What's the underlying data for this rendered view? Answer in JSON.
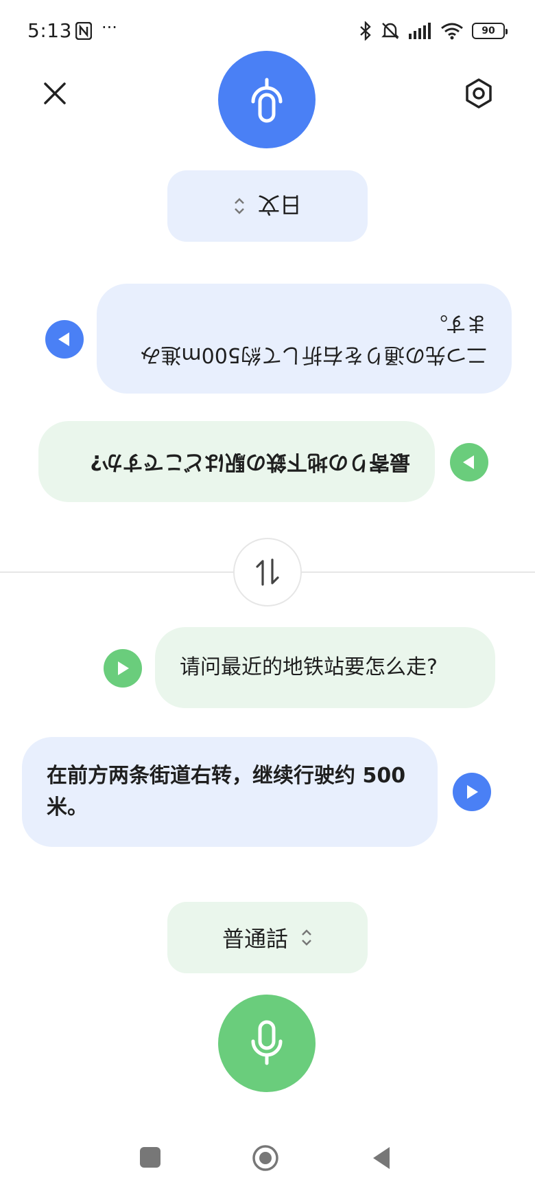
{
  "status_bar": {
    "time": "5:13",
    "more": "···",
    "battery": "90"
  },
  "header": {
    "close_icon": "close-icon",
    "settings_icon": "settings-icon",
    "mic_color": "#4a80f5"
  },
  "top_language": {
    "label": "日文",
    "arrows": "⌃⌄"
  },
  "conversation": {
    "japanese_response": "二つ先の通りを右折して約500m進みます。",
    "japanese_question": "最寄りの地下鉄の駅はどこですか?",
    "chinese_question": "请问最近的地铁站要怎么走?",
    "chinese_response": "在前方两条街道右转，继续行驶约 500 米。"
  },
  "bottom_language": {
    "label": "普通話",
    "arrows": "⌃⌄"
  },
  "colors": {
    "blue": "#4a80f5",
    "green": "#6acd7c",
    "blue_bubble": "#e8effd",
    "green_bubble": "#eaf6ec"
  }
}
